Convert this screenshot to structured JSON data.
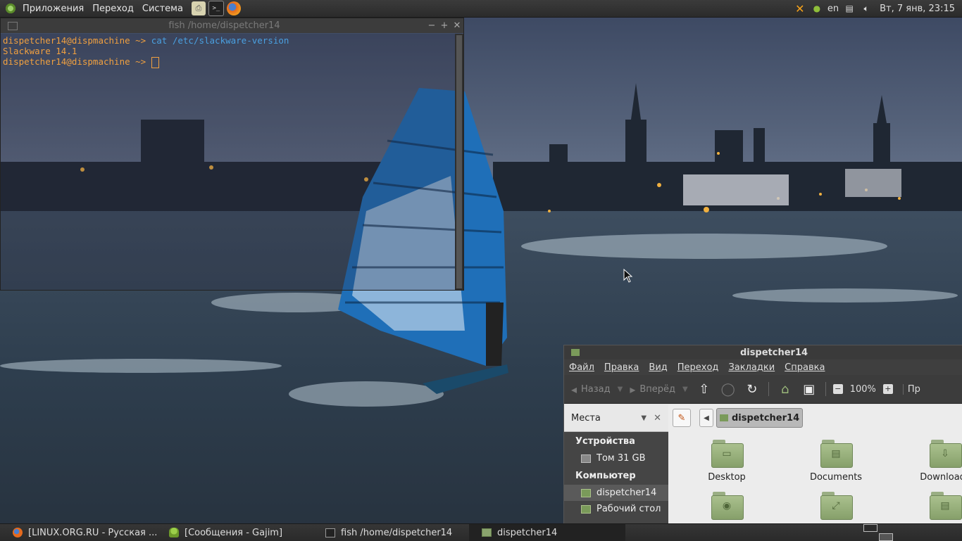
{
  "top_panel": {
    "menus": [
      "Приложения",
      "Переход",
      "Система"
    ],
    "launchers": [
      "printer-icon",
      "terminal-icon",
      "firefox-icon"
    ],
    "tray": {
      "lang": "en",
      "clock": "Вт, 7 янв, 23:15",
      "icons": [
        "network-cross-icon",
        "gajim-icon",
        "clipboard-icon",
        "volume-icon"
      ]
    }
  },
  "terminal": {
    "title": "fish  /home/dispetcher14",
    "lines": [
      {
        "prompt": "dispetcher14@dispmachine ~>",
        "command": "cat /etc/slackware-version"
      },
      {
        "output": "Slackware 14.1"
      },
      {
        "prompt": "dispetcher14@dispmachine ~>",
        "command": ""
      }
    ]
  },
  "file_manager": {
    "title": "dispetcher14",
    "menu": [
      "Файл",
      "Правка",
      "Вид",
      "Переход",
      "Закладки",
      "Справка"
    ],
    "toolbar": {
      "back": "Назад",
      "forward": "Вперёд",
      "zoom": "100%",
      "more": "Пр"
    },
    "sidebar": {
      "header": "Места",
      "sections": [
        {
          "title": "Устройства",
          "items": [
            {
              "label": "Том 31 GB",
              "icon": "drive-icon"
            }
          ]
        },
        {
          "title": "Компьютер",
          "items": [
            {
              "label": "dispetcher14",
              "icon": "home-folder-icon",
              "selected": true
            },
            {
              "label": "Рабочий стол",
              "icon": "desktop-folder-icon"
            }
          ]
        }
      ]
    },
    "path": {
      "current": "dispetcher14"
    },
    "items": [
      {
        "name": "Desktop",
        "glyph": "▭"
      },
      {
        "name": "Documents",
        "glyph": "▤"
      },
      {
        "name": "Downloads",
        "glyph": "⇩"
      },
      {
        "name": "",
        "glyph": "◉"
      },
      {
        "name": "",
        "glyph": "⤢"
      },
      {
        "name": "",
        "glyph": "▤"
      }
    ]
  },
  "taskbar": {
    "tasks": [
      {
        "label": "[LINUX.ORG.RU - Русская ...",
        "icon": "firefox-icon"
      },
      {
        "label": "[Сообщения - Gajim]",
        "icon": "gajim-icon"
      },
      {
        "label": "fish  /home/dispetcher14",
        "icon": "terminal-icon"
      },
      {
        "label": "dispetcher14",
        "icon": "folder-icon",
        "active": true
      }
    ]
  }
}
